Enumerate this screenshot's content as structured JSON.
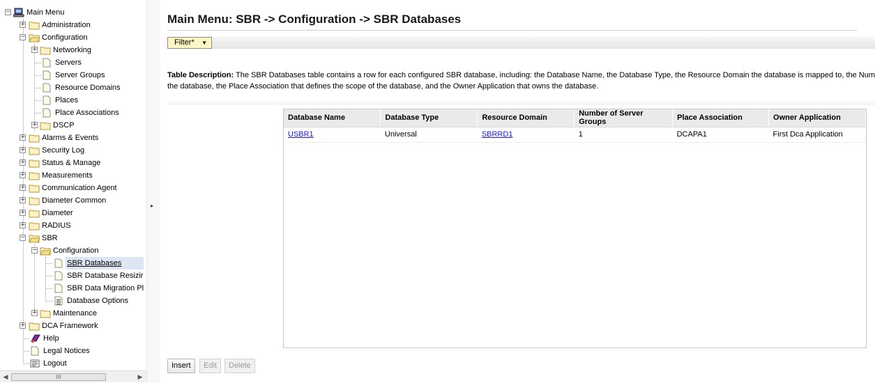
{
  "tree": {
    "root": "Main Menu",
    "items": {
      "administration": "Administration",
      "configuration": "Configuration",
      "networking": "Networking",
      "servers": "Servers",
      "server_groups": "Server Groups",
      "resource_domains": "Resource Domains",
      "places": "Places",
      "place_associations": "Place Associations",
      "dscp": "DSCP",
      "alarms_events": "Alarms & Events",
      "security_log": "Security Log",
      "status_manage": "Status & Manage",
      "measurements": "Measurements",
      "communication_agent": "Communication Agent",
      "diameter_common": "Diameter Common",
      "diameter": "Diameter",
      "radius": "RADIUS",
      "sbr": "SBR",
      "sbr_configuration": "Configuration",
      "sbr_databases": "SBR Databases",
      "sbr_database_resizing": "SBR Database Resizir",
      "sbr_data_migration": "SBR Data Migration Pl",
      "database_options": "Database Options",
      "maintenance": "Maintenance",
      "dca_framework": "DCA Framework",
      "help": "Help",
      "legal_notices": "Legal Notices",
      "logout": "Logout"
    },
    "scroll_thumb_glyph": "III"
  },
  "page": {
    "title": "Main Menu: SBR -> Configuration -> SBR Databases",
    "filter_label": "Filter*",
    "desc_label": "Table Description:",
    "desc_line1": "The SBR Databases table contains a row for each configured SBR database, including: the Database Name, the Database Type, the Resource Domain the database is mapped to, the Num",
    "desc_line2": "the database, the Place Association that defines the scope of the database, and the Owner Application that owns the database."
  },
  "table": {
    "columns": [
      "Database Name",
      "Database Type",
      "Resource Domain",
      "Number of Server Groups",
      "Place Association",
      "Owner Application"
    ],
    "rows": [
      [
        "USBR1",
        "Universal",
        "SBRRD1",
        "1",
        "DCAPA1",
        "First Dca Application"
      ]
    ]
  },
  "actions": {
    "insert": "Insert",
    "edit": "Edit",
    "delete": "Delete"
  },
  "colors": {
    "link": "#1a1adc",
    "filter_bg": "#fff6c4",
    "selected_bg": "#dde6f2",
    "header_bg": "#eaeaea"
  }
}
